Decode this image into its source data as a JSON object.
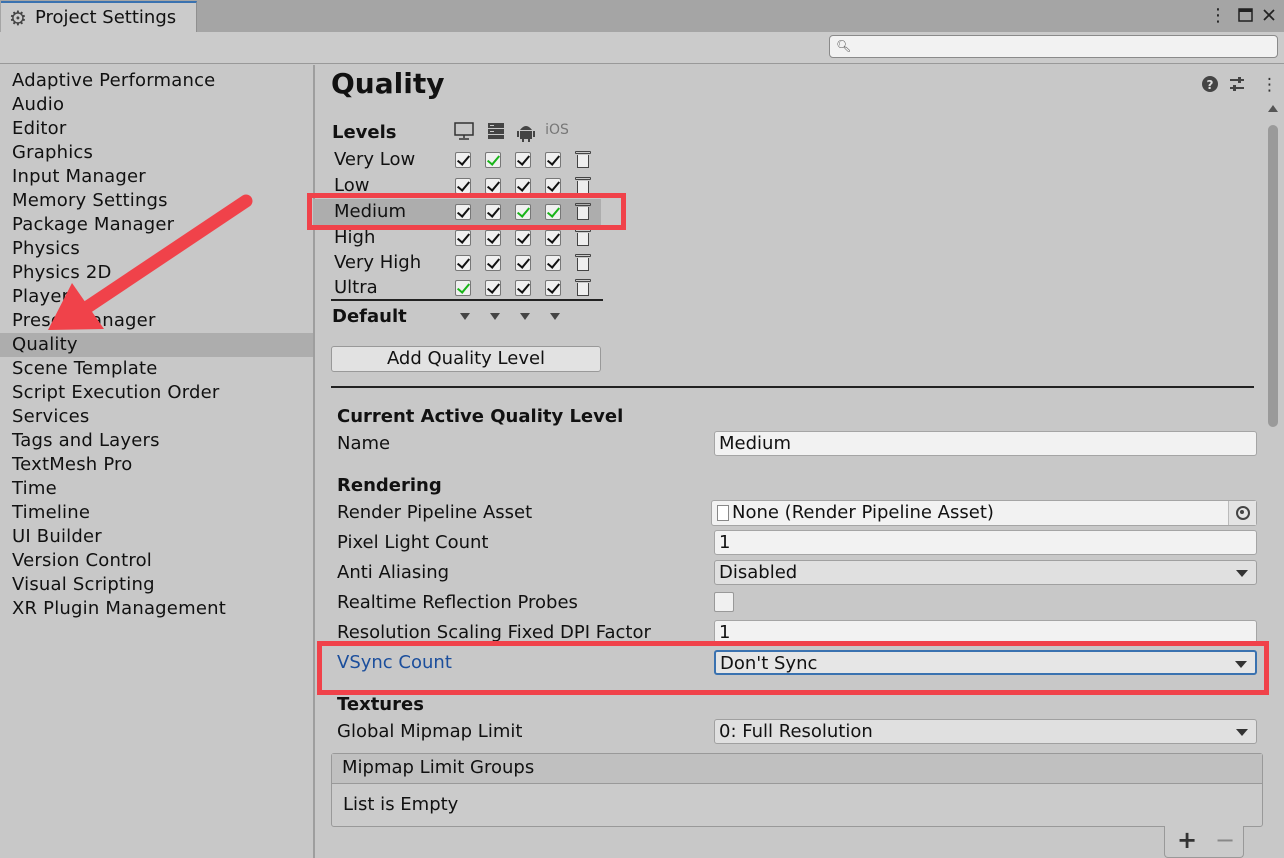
{
  "window": {
    "tab_title": "Project Settings",
    "tab_icon": "gear-icon"
  },
  "search": {
    "placeholder": ""
  },
  "sidebar": {
    "items": [
      {
        "label": "Adaptive Performance"
      },
      {
        "label": "Audio"
      },
      {
        "label": "Editor"
      },
      {
        "label": "Graphics"
      },
      {
        "label": "Input Manager"
      },
      {
        "label": "Memory Settings"
      },
      {
        "label": "Package Manager"
      },
      {
        "label": "Physics"
      },
      {
        "label": "Physics 2D"
      },
      {
        "label": "Player"
      },
      {
        "label": "Preset Manager"
      },
      {
        "label": "Quality"
      },
      {
        "label": "Scene Template"
      },
      {
        "label": "Script Execution Order"
      },
      {
        "label": "Services"
      },
      {
        "label": "Tags and Layers"
      },
      {
        "label": "TextMesh Pro"
      },
      {
        "label": "Time"
      },
      {
        "label": "Timeline"
      },
      {
        "label": "UI Builder"
      },
      {
        "label": "Version Control"
      },
      {
        "label": "Visual Scripting"
      },
      {
        "label": "XR Plugin Management"
      }
    ],
    "selected": "Quality"
  },
  "main": {
    "title": "Quality",
    "levels": {
      "header": "Levels",
      "platform_ios_label": "iOS",
      "rows": [
        {
          "name": "Very Low"
        },
        {
          "name": "Low"
        },
        {
          "name": "Medium"
        },
        {
          "name": "High"
        },
        {
          "name": "Very High"
        },
        {
          "name": "Ultra"
        }
      ],
      "default_label": "Default",
      "add_button": "Add Quality Level"
    },
    "current": {
      "section_title": "Current Active Quality Level",
      "name_label": "Name",
      "name_value": "Medium"
    },
    "rendering": {
      "section_title": "Rendering",
      "render_pipeline_label": "Render Pipeline Asset",
      "render_pipeline_value": "None (Render Pipeline Asset)",
      "pixel_light_label": "Pixel Light Count",
      "pixel_light_value": "1",
      "anti_aliasing_label": "Anti Aliasing",
      "anti_aliasing_value": "Disabled",
      "realtime_reflection_label": "Realtime Reflection Probes",
      "resolution_scaling_label": "Resolution Scaling Fixed DPI Factor",
      "resolution_scaling_value": "1",
      "vsync_label": "VSync Count",
      "vsync_value": "Don't Sync"
    },
    "textures": {
      "section_title": "Textures",
      "mipmap_label": "Global Mipmap Limit",
      "mipmap_value": "0: Full Resolution",
      "groups_header": "Mipmap Limit Groups",
      "groups_empty": "List is Empty",
      "add_symbol": "+",
      "remove_symbol": "−"
    }
  },
  "colors": {
    "highlight_annotation": "#f0424a",
    "selected_bg": "#adadad",
    "link_blue": "#1b4e9c",
    "check_green": "#19b419"
  }
}
